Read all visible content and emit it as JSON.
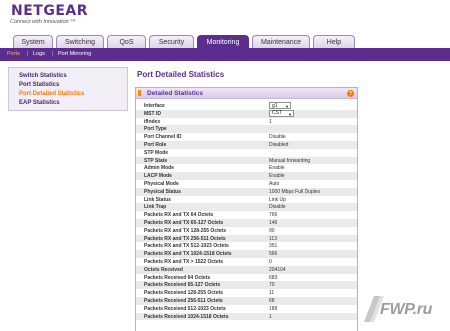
{
  "brand": {
    "logo": "NETGEAR",
    "tagline": "Connect with Innovation ™"
  },
  "tabs": [
    {
      "label": "System"
    },
    {
      "label": "Switching"
    },
    {
      "label": "QoS"
    },
    {
      "label": "Security"
    },
    {
      "label": "Monitoring",
      "active": true
    },
    {
      "label": "Maintenance"
    },
    {
      "label": "Help"
    }
  ],
  "subnav": {
    "items": [
      "Ports",
      "Logs",
      "Port Mirroring"
    ],
    "separator": "|"
  },
  "sidebar": {
    "items": [
      {
        "label": "Switch Statistics"
      },
      {
        "label": "Port Statistics"
      },
      {
        "label": "Port Detailed Statistics",
        "active": true
      },
      {
        "label": "EAP Statistics"
      }
    ]
  },
  "page_title": "Port Detailed Statistics",
  "panel": {
    "title": "Detailed Statistics",
    "help_glyph": "?",
    "interface": {
      "label": "Interface",
      "value": "g1"
    },
    "mst_id": {
      "label": "MST ID",
      "value": "CST"
    },
    "rows": [
      {
        "label": "ifIndex",
        "value": "1"
      },
      {
        "label": "Port Type",
        "value": ""
      },
      {
        "label": "Port Channel ID",
        "value": "Disable"
      },
      {
        "label": "Port Role",
        "value": "Disabled"
      },
      {
        "label": "STP Mode",
        "value": ""
      },
      {
        "label": "STP State",
        "value": "Manual forwarding"
      },
      {
        "label": "Admin Mode",
        "value": "Enable"
      },
      {
        "label": "LACP Mode",
        "value": "Enable"
      },
      {
        "label": "Physical Mode",
        "value": "Auto"
      },
      {
        "label": "Physical Status",
        "value": "1000 Mbps Full Duplex"
      },
      {
        "label": "Link Status",
        "value": "Link Up"
      },
      {
        "label": "Link Trap",
        "value": "Disable"
      },
      {
        "label": "Packets RX and TX 64 Octets",
        "value": "766"
      },
      {
        "label": "Packets RX and TX 65-127 Octets",
        "value": "146"
      },
      {
        "label": "Packets RX and TX 128-255 Octets",
        "value": "90"
      },
      {
        "label": "Packets RX and TX 256-511 Octets",
        "value": "113"
      },
      {
        "label": "Packets RX and TX 512-1023 Octets",
        "value": "351"
      },
      {
        "label": "Packets RX and TX 1024-1518 Octets",
        "value": "566"
      },
      {
        "label": "Packets RX and TX > 1522 Octets",
        "value": "0"
      },
      {
        "label": "Octets Received",
        "value": "204104"
      },
      {
        "label": "Packets Received 64 Octets",
        "value": "683"
      },
      {
        "label": "Packets Received 65-127 Octets",
        "value": "70"
      },
      {
        "label": "Packets Received 128-255 Octets",
        "value": "11"
      },
      {
        "label": "Packets Received 256-511 Octets",
        "value": "68"
      },
      {
        "label": "Packets Received 512-1023 Octets",
        "value": "189"
      },
      {
        "label": "Packets Received 1024-1518 Octets",
        "value": "1"
      }
    ]
  },
  "watermark": "FWP.ru",
  "colors": {
    "brand_purple": "#5b2d8e",
    "accent_orange": "#ff7a00",
    "row_shade": "#eaeaea"
  }
}
